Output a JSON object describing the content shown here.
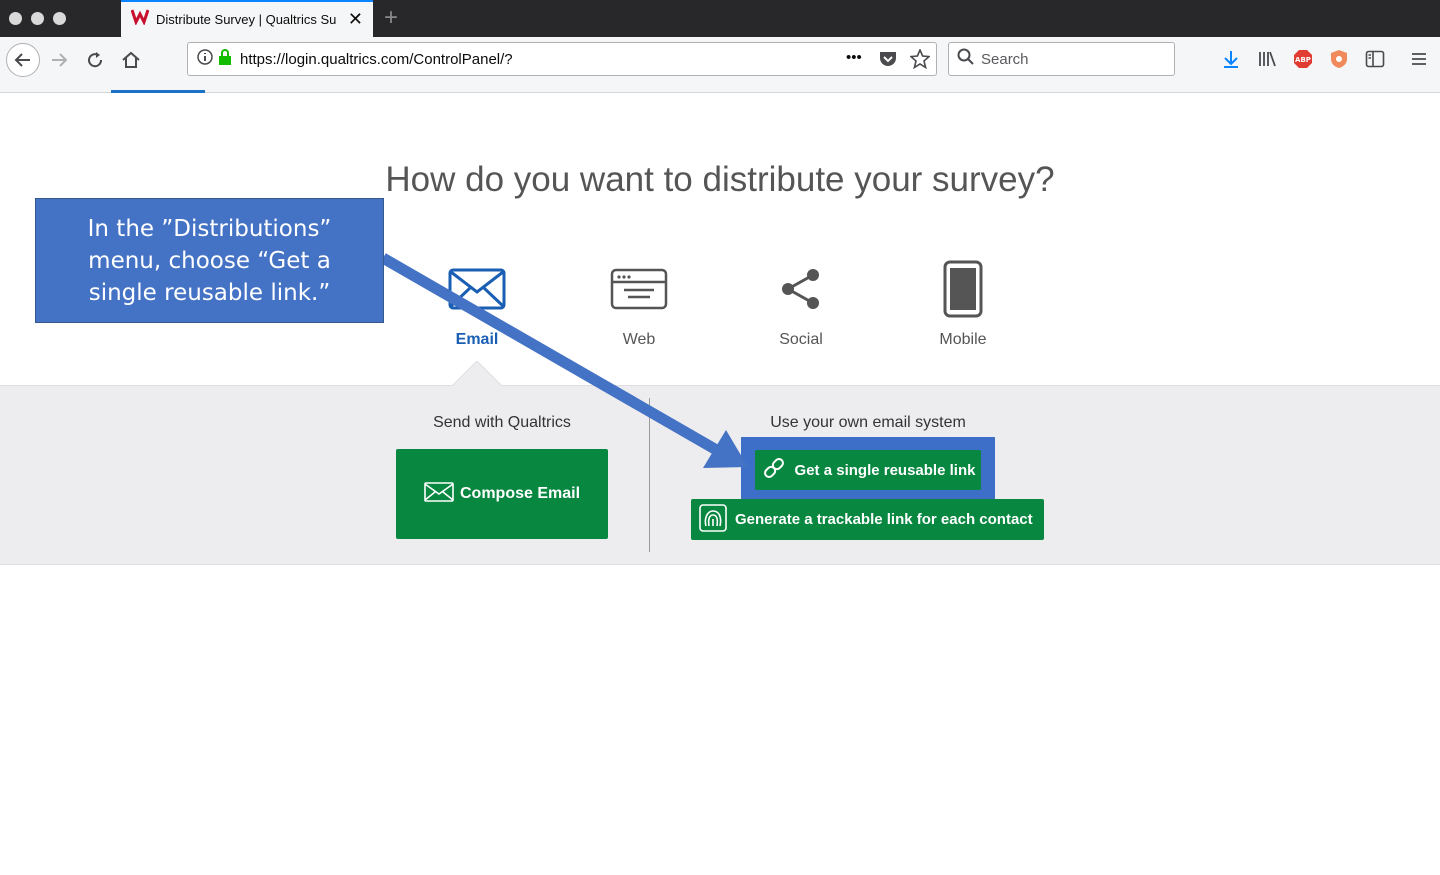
{
  "browser": {
    "tab_title": "Distribute Survey | Qualtrics Su",
    "new_tab_symbol": "+",
    "url": "https://login.qualtrics.com/ControlPanel/?",
    "search_placeholder": "Search",
    "url_actions_symbol": "•••"
  },
  "page": {
    "heading": "How do you want to distribute your survey?",
    "methods": [
      {
        "label": "Email",
        "icon": "envelope-icon",
        "active": true
      },
      {
        "label": "Web",
        "icon": "browser-window-icon",
        "active": false
      },
      {
        "label": "Social",
        "icon": "share-icon",
        "active": false
      },
      {
        "label": "Mobile",
        "icon": "mobile-phone-icon",
        "active": false
      }
    ],
    "send_with_qualtrics": {
      "title": "Send with Qualtrics",
      "compose_label": "Compose Email"
    },
    "own_email_system": {
      "title": "Use your own email system",
      "reusable_link_label": "Get a single reusable link",
      "trackable_link_label": "Generate a trackable link for each contact"
    }
  },
  "annotation": {
    "text": "In the ”Distributions” menu, choose “Get a single reusable link.”"
  },
  "colors": {
    "accent_blue": "#1a5fb4",
    "button_green": "#07873f",
    "callout_blue": "#4472c4"
  }
}
